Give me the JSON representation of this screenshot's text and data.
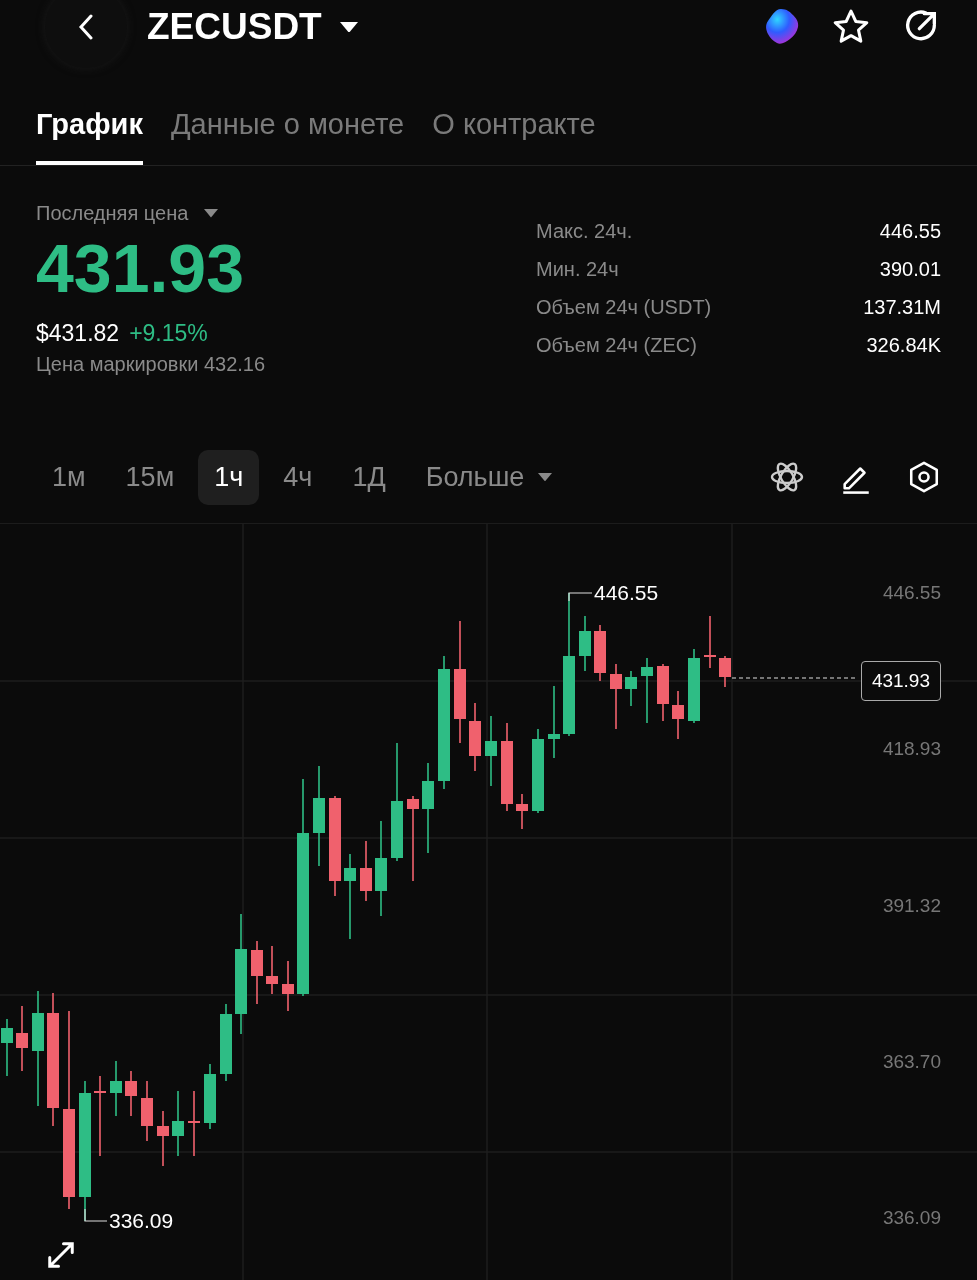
{
  "header": {
    "symbol": "ZECUSDT"
  },
  "tabs": [
    {
      "label": "График",
      "selected": true
    },
    {
      "label": "Данные о монете",
      "selected": false
    },
    {
      "label": "О контракте",
      "selected": false
    }
  ],
  "price": {
    "label": "Последняя цена",
    "last": "431.93",
    "usd": "$431.82",
    "change": "+9.15%",
    "mark": "Цена маркировки 432.16"
  },
  "stats": [
    {
      "label": "Макс. 24ч.",
      "value": "446.55"
    },
    {
      "label": "Мин. 24ч",
      "value": "390.01"
    },
    {
      "label": "Объем 24ч (USDT)",
      "value": "137.31M"
    },
    {
      "label": "Объем 24ч (ZEC)",
      "value": "326.84K"
    }
  ],
  "intervals": [
    {
      "label": "1м",
      "selected": false
    },
    {
      "label": "15м",
      "selected": false
    },
    {
      "label": "1ч",
      "selected": true
    },
    {
      "label": "4ч",
      "selected": false
    },
    {
      "label": "1Д",
      "selected": false
    }
  ],
  "more": "Больше",
  "chart": {
    "price_axis": [
      "446.55",
      "418.93",
      "391.32",
      "363.70",
      "336.09"
    ],
    "high_marker": "446.55",
    "low_marker": "336.09",
    "current_price": "431.93"
  }
}
